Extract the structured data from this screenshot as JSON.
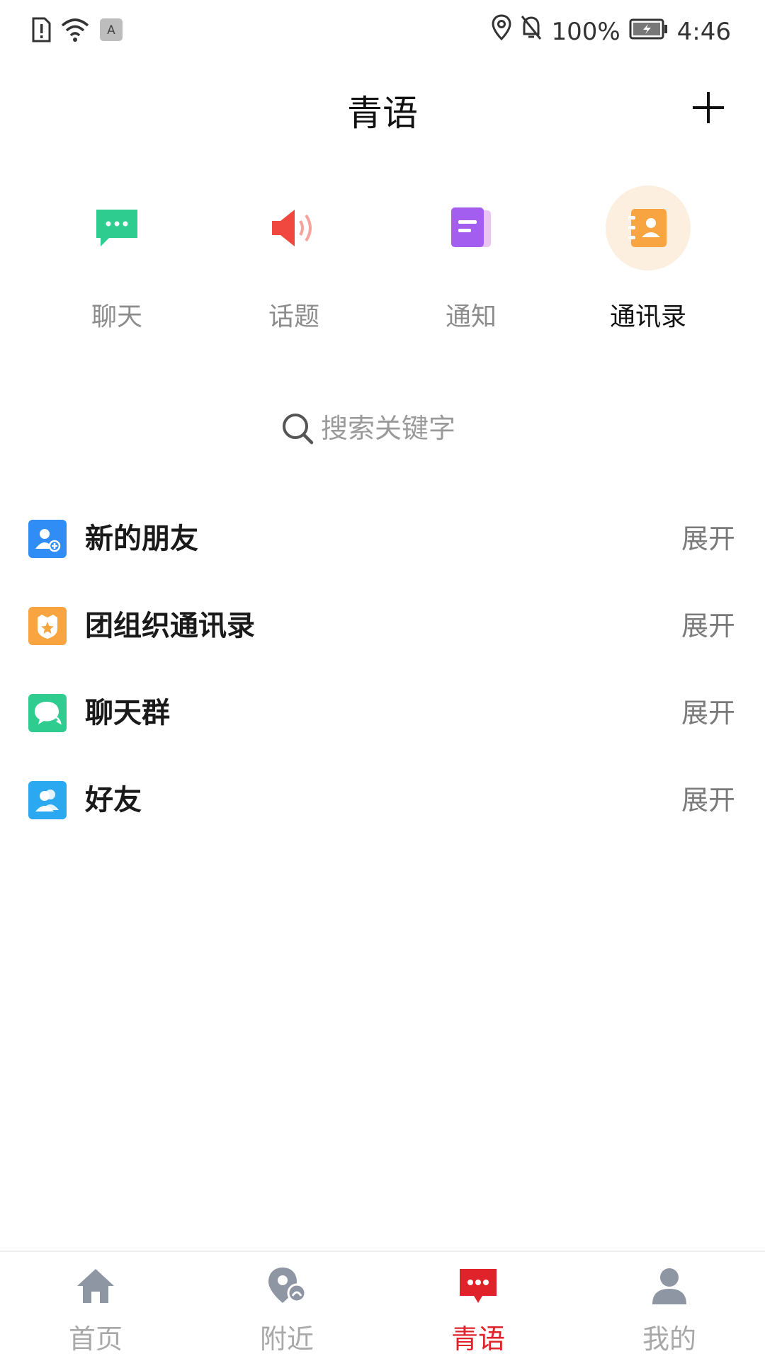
{
  "status_bar": {
    "battery_percent": "100%",
    "time": "4:46",
    "keyboard_glyph": "A"
  },
  "header": {
    "title": "青语"
  },
  "quick_tabs": [
    {
      "label": "聊天",
      "icon": "chat-bubble-icon",
      "color": "#2ecc8f",
      "active": false
    },
    {
      "label": "话题",
      "icon": "speaker-icon",
      "color": "#f0483e",
      "active": false
    },
    {
      "label": "通知",
      "icon": "document-icon",
      "color": "#a35ef0",
      "active": false
    },
    {
      "label": "通讯录",
      "icon": "contacts-book-icon",
      "color": "#f8a440",
      "active": true
    }
  ],
  "search": {
    "placeholder": "搜索关键字"
  },
  "sections": [
    {
      "label": "新的朋友",
      "expand": "展开",
      "icon": "new-friend-icon",
      "color": "#2f8df5"
    },
    {
      "label": "团组织通讯录",
      "expand": "展开",
      "icon": "org-badge-icon",
      "color": "#f8a440"
    },
    {
      "label": "聊天群",
      "expand": "展开",
      "icon": "group-chat-icon",
      "color": "#2ecc8f"
    },
    {
      "label": "好友",
      "expand": "展开",
      "icon": "friends-icon",
      "color": "#2aa9f0"
    }
  ],
  "bottom_nav": [
    {
      "label": "首页",
      "icon": "home-icon",
      "active": false
    },
    {
      "label": "附近",
      "icon": "nearby-icon",
      "active": false
    },
    {
      "label": "青语",
      "icon": "message-icon",
      "active": true
    },
    {
      "label": "我的",
      "icon": "profile-icon",
      "active": false
    }
  ],
  "colors": {
    "accent": "#e0232a",
    "inactive_text": "#a8a8a8",
    "active_tab_bg": "#fcefe0"
  }
}
